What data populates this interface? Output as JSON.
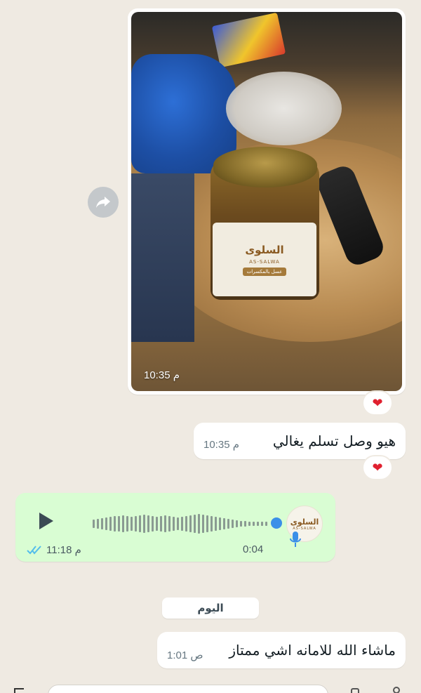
{
  "messages": {
    "image": {
      "time": "10:35 م",
      "jar_brand": "السلوى",
      "jar_brand_latin": "AS-SALWA",
      "jar_ribbon": "عسل بالمكسرات",
      "reaction": "❤"
    },
    "text1": {
      "text": "هيو وصل تسلم يغالي",
      "time": "10:35 م",
      "reaction": "❤"
    },
    "voice": {
      "duration": "0:04",
      "time": "11:18 م",
      "avatar_brand": "السلوى",
      "avatar_brand_latin": "AS-SALWA",
      "read_status": "read"
    },
    "date_divider": "اليوم",
    "text2": {
      "text": "ماشاء الله للامانه اشي ممتاز",
      "time": "1:01 ص"
    }
  },
  "colors": {
    "chat_background": "#efeae2",
    "incoming_bubble": "#ffffff",
    "outgoing_bubble": "#d9fdd3",
    "heart": "#e0202f",
    "read_ticks": "#53bdeb",
    "voice_dot": "#3b8fe8"
  },
  "icons": {
    "forward": "forward-arrow-icon",
    "play": "play-icon",
    "mic": "microphone-icon",
    "ticks": "double-check-icon"
  }
}
